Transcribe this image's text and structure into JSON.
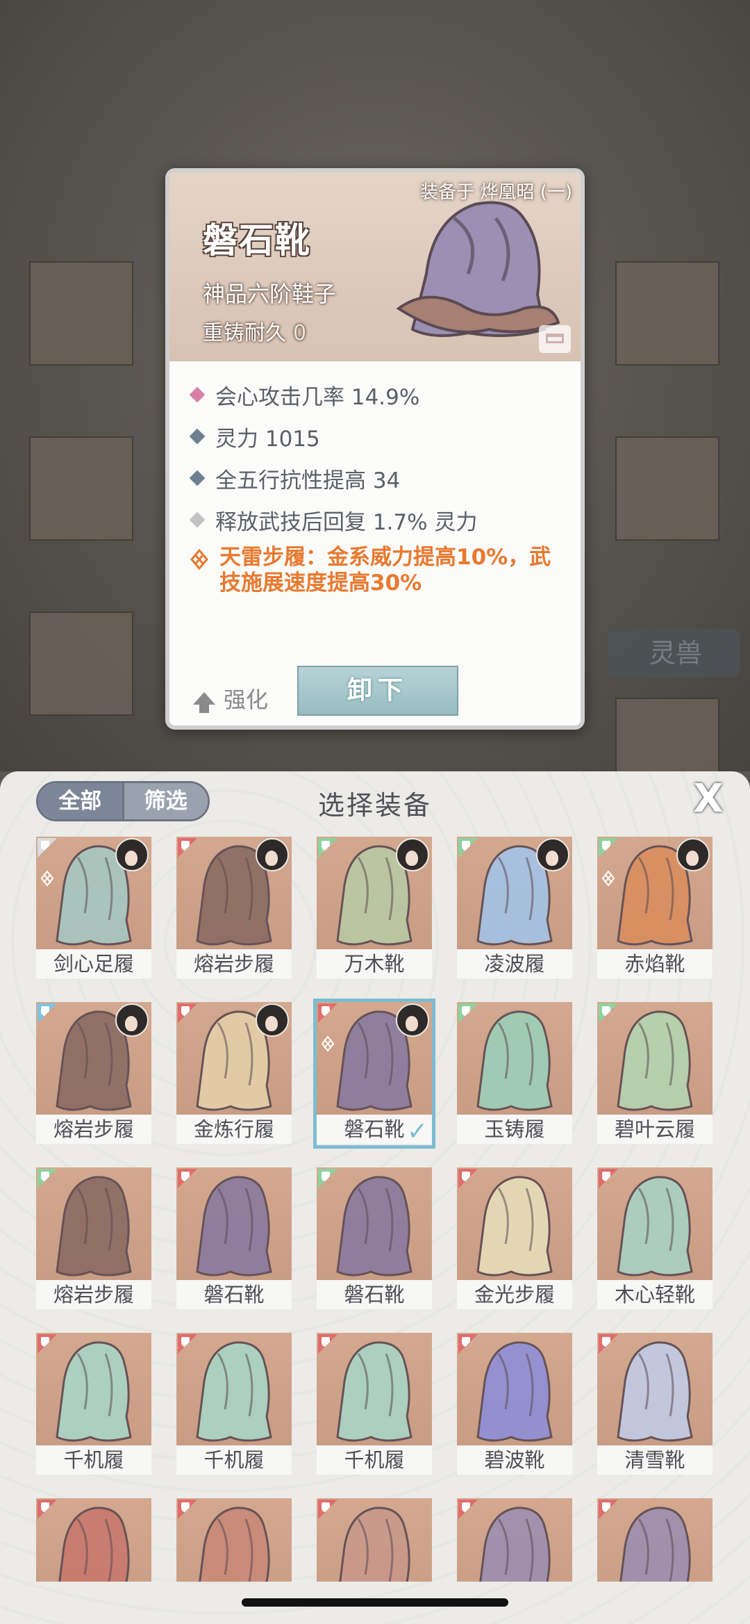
{
  "detail": {
    "equipped_on": "装备于 烨凰昭 (一)",
    "name": "磐石靴",
    "grade": "神品六阶鞋子",
    "reforge_label": "重铸耐久",
    "reforge_value": "0",
    "attrs": [
      {
        "text": "会心攻击几率 14.9%",
        "color": "#d97fa6"
      },
      {
        "text": "灵力 1015",
        "color": "#6e7f91"
      },
      {
        "text": "全五行抗性提高 34",
        "color": "#6e7f91"
      },
      {
        "text": "释放武技后回复 1.7% 灵力",
        "color": "#c2c2c2"
      }
    ],
    "skill_line1": "天雷步履：金系威力提高10%，武",
    "skill_line2": "技施展速度提高30%",
    "strengthen_label": "强化",
    "unequip_label": "卸下"
  },
  "background": {
    "tag_label": "灵兽"
  },
  "panel": {
    "tab_all": "全部",
    "tab_filter": "筛选",
    "title": "选择装备",
    "close": "X",
    "items": [
      {
        "name": "剑心足履",
        "badge": "#d8dde0",
        "avatar": true,
        "skill": true,
        "color": "#a6c8c2"
      },
      {
        "name": "熔岩步履",
        "badge": "#e06c6c",
        "avatar": true,
        "skill": false,
        "color": "#8b6b63"
      },
      {
        "name": "万木靴",
        "badge": "#8fd19e",
        "avatar": true,
        "skill": false,
        "color": "#b9c9a4"
      },
      {
        "name": "凌波履",
        "badge": "#8fd19e",
        "avatar": true,
        "skill": false,
        "color": "#a4c3e6"
      },
      {
        "name": "赤焰靴",
        "badge": "#8fd19e",
        "avatar": true,
        "skill": true,
        "color": "#d98e5f"
      },
      {
        "name": "熔岩步履",
        "badge": "#7ec3e0",
        "avatar": true,
        "skill": false,
        "color": "#8b6b63"
      },
      {
        "name": "金炼行履",
        "badge": "#e06c6c",
        "avatar": true,
        "skill": false,
        "color": "#e4cfa9"
      },
      {
        "name": "磐石靴",
        "badge": "#e06c6c",
        "avatar": true,
        "skill": true,
        "color": "#8a7aa0",
        "selected": true
      },
      {
        "name": "玉铸履",
        "badge": "#8fd19e",
        "avatar": false,
        "skill": false,
        "color": "#9ccfb8"
      },
      {
        "name": "碧叶云履",
        "badge": "#8fd19e",
        "avatar": false,
        "skill": false,
        "color": "#b4d4b0"
      },
      {
        "name": "熔岩步履",
        "badge": "#8fd19e",
        "avatar": false,
        "skill": false,
        "color": "#8b6b63"
      },
      {
        "name": "磐石靴",
        "badge": "#e06c6c",
        "avatar": false,
        "skill": false,
        "color": "#8a7aa0"
      },
      {
        "name": "磐石靴",
        "badge": "#8fd19e",
        "avatar": false,
        "skill": false,
        "color": "#8a7aa0"
      },
      {
        "name": "金光步履",
        "badge": "#e06c6c",
        "avatar": false,
        "skill": false,
        "color": "#e6ddb8"
      },
      {
        "name": "木心轻靴",
        "badge": "#e06c6c",
        "avatar": false,
        "skill": false,
        "color": "#a8d1c4"
      },
      {
        "name": "千机履",
        "badge": "#e06c6c",
        "avatar": false,
        "skill": false,
        "color": "#a9d5c6"
      },
      {
        "name": "千机履",
        "badge": "#e06c6c",
        "avatar": false,
        "skill": false,
        "color": "#a9d5c6"
      },
      {
        "name": "千机履",
        "badge": "#e06c6c",
        "avatar": false,
        "skill": false,
        "color": "#a9d5c6"
      },
      {
        "name": "碧波靴",
        "badge": "#e06c6c",
        "avatar": false,
        "skill": false,
        "color": "#8f8fd8"
      },
      {
        "name": "清雪靴",
        "badge": "#e06c6c",
        "avatar": false,
        "skill": false,
        "color": "#c2cbe6"
      },
      {
        "name": "",
        "badge": "#e06c6c",
        "avatar": false,
        "skill": false,
        "color": "#c9786e"
      },
      {
        "name": "",
        "badge": "#e06c6c",
        "avatar": false,
        "skill": false,
        "color": "#c98a78"
      },
      {
        "name": "",
        "badge": "#e06c6c",
        "avatar": false,
        "skill": false,
        "color": "#c9988a"
      },
      {
        "name": "",
        "badge": "#e06c6c",
        "avatar": false,
        "skill": false,
        "color": "#9d8fb0"
      },
      {
        "name": "",
        "badge": "#e06c6c",
        "avatar": false,
        "skill": false,
        "color": "#9d8fb0"
      }
    ]
  }
}
